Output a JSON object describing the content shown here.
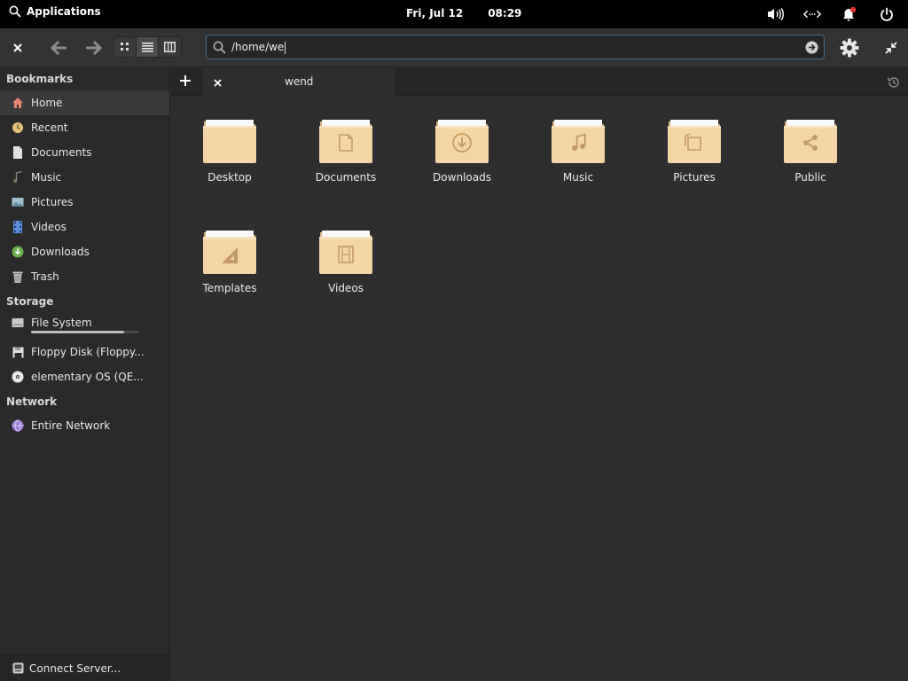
{
  "panel": {
    "applications_label": "Applications",
    "date": "Fri, Jul 12",
    "time": "08:29",
    "tray_icons": [
      "volume-icon",
      "network-icon",
      "notification-bell-icon",
      "power-icon"
    ]
  },
  "headerbar": {
    "location_path": "/home/we",
    "view_modes": [
      "grid",
      "list",
      "columns"
    ],
    "active_view": "list"
  },
  "sidebar": {
    "sections": {
      "bookmarks": "Bookmarks",
      "storage": "Storage",
      "network": "Network"
    },
    "bookmarks": [
      {
        "label": "Home",
        "icon": "home-icon"
      },
      {
        "label": "Recent",
        "icon": "recent-icon"
      },
      {
        "label": "Documents",
        "icon": "document-icon"
      },
      {
        "label": "Music",
        "icon": "music-icon"
      },
      {
        "label": "Pictures",
        "icon": "pictures-icon"
      },
      {
        "label": "Videos",
        "icon": "videos-icon"
      },
      {
        "label": "Downloads",
        "icon": "downloads-icon"
      },
      {
        "label": "Trash",
        "icon": "trash-icon"
      }
    ],
    "storage": [
      {
        "label": "File System",
        "icon": "drive-icon",
        "usage_fraction": 0.86
      },
      {
        "label": "Floppy Disk (Floppy...",
        "icon": "floppy-icon"
      },
      {
        "label": "elementary OS (QE...",
        "icon": "disc-icon"
      }
    ],
    "network": [
      {
        "label": "Entire Network",
        "icon": "network-globe-icon"
      }
    ],
    "connect_server": "Connect Server..."
  },
  "tabs": [
    {
      "label": "wend"
    }
  ],
  "files": [
    {
      "label": "Desktop",
      "emblem": "none"
    },
    {
      "label": "Documents",
      "emblem": "document"
    },
    {
      "label": "Downloads",
      "emblem": "download"
    },
    {
      "label": "Music",
      "emblem": "music"
    },
    {
      "label": "Pictures",
      "emblem": "picture"
    },
    {
      "label": "Public",
      "emblem": "share"
    },
    {
      "label": "Templates",
      "emblem": "template"
    },
    {
      "label": "Videos",
      "emblem": "video"
    }
  ],
  "colors": {
    "folder_body": "#f4d5a4",
    "folder_tab": "#d9b27c",
    "accent_blue": "#4a6a8a",
    "downloads_green": "#6ab04c",
    "notification_red": "#e0332f"
  }
}
